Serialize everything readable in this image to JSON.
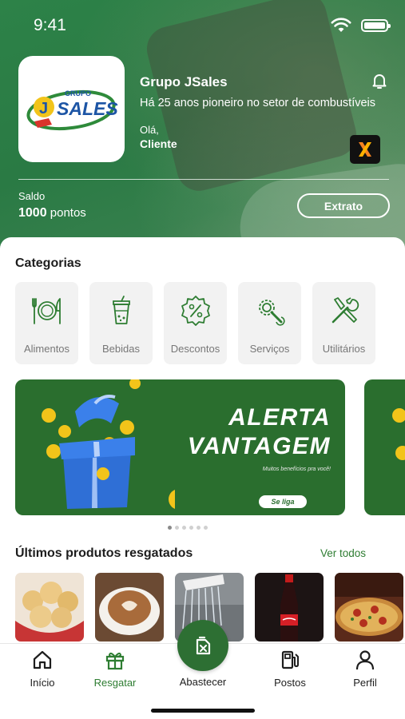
{
  "status_bar": {
    "time": "9:41"
  },
  "header": {
    "company_name": "Grupo JSales",
    "tagline": "Há 25 anos pioneiro no setor de combustíveis",
    "greeting": "Olá,",
    "user_name": "Cliente",
    "logo": {
      "top_text": "GRUPO",
      "letter": "J",
      "brand": "SALES"
    },
    "balance_label": "Saldo",
    "balance_points": "1000",
    "balance_unit": "pontos",
    "statement_button": "Extrato"
  },
  "categories": {
    "title": "Categorias",
    "items": [
      {
        "label": "Alimentos",
        "icon": "cutlery-plate-icon"
      },
      {
        "label": "Bebidas",
        "icon": "drink-cup-icon"
      },
      {
        "label": "Descontos",
        "icon": "percent-badge-icon"
      },
      {
        "label": "Serviços",
        "icon": "gear-wrench-icon"
      },
      {
        "label": "Utilitários",
        "icon": "tools-icon"
      }
    ]
  },
  "banner": {
    "title_line1": "ALERTA",
    "title_line2": "VANTAGEM",
    "subtitle": "Muitos benefícios pra você!",
    "cta": "Se liga",
    "slides_total": 6,
    "active_slide": 1
  },
  "products": {
    "title": "Últimos produtos resgatados",
    "see_all": "Ver todos",
    "items": [
      {
        "name": "pao-de-queijo-image"
      },
      {
        "name": "cappuccino-image"
      },
      {
        "name": "shower-image"
      },
      {
        "name": "coca-cola-bottle-image"
      },
      {
        "name": "pizza-image"
      }
    ]
  },
  "bottom_nav": {
    "items": [
      {
        "label": "Início",
        "icon": "home-icon"
      },
      {
        "label": "Resgatar",
        "icon": "gift-icon",
        "active": true
      },
      {
        "label": "Abastecer",
        "icon": "fuel-can-icon"
      },
      {
        "label": "Postos",
        "icon": "gas-station-icon"
      },
      {
        "label": "Perfil",
        "icon": "user-icon"
      }
    ]
  },
  "colors": {
    "brand_green": "#2d6f33",
    "header_green": "#2a7a44",
    "link_green": "#2e7d32",
    "category_bg": "#f2f2f2"
  }
}
